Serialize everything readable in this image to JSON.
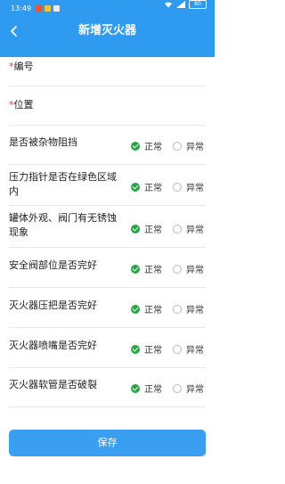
{
  "status_bar": {
    "time": "13:49",
    "battery": "80"
  },
  "header": {
    "title": "新增灭火器"
  },
  "fields": [
    {
      "required_mark": "*",
      "label": "编号"
    },
    {
      "required_mark": "*",
      "label": "位置"
    }
  ],
  "checks": [
    {
      "label": "是否被杂物阻挡",
      "selected": "正常"
    },
    {
      "label": "压力指针是否在绿色区域内",
      "selected": "正常"
    },
    {
      "label": "罐体外观、阀门有无锈蚀现象",
      "selected": "正常"
    },
    {
      "label": "安全阀部位是否完好",
      "selected": "正常"
    },
    {
      "label": "灭火器压把是否完好",
      "selected": "正常"
    },
    {
      "label": "灭火器喷嘴是否完好",
      "selected": "正常"
    },
    {
      "label": "灭火器软管是否破裂",
      "selected": "正常"
    }
  ],
  "options": {
    "normal": "正常",
    "abnormal": "异常"
  },
  "save_button": {
    "label": "保存"
  },
  "colors": {
    "header": "#2f9bf0",
    "checked": "#27a744",
    "required": "#e8453c",
    "button": "#3a9ef1"
  }
}
